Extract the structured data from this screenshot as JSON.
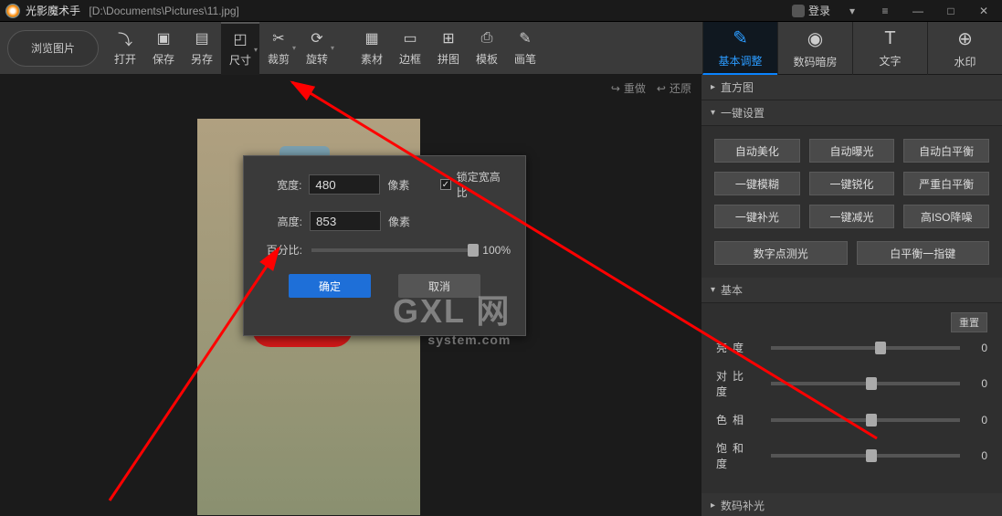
{
  "titlebar": {
    "app_name": "光影魔术手",
    "file_path": "[D:\\Documents\\Pictures\\11.jpg]",
    "login_label": "登录"
  },
  "toolbar": {
    "browse": "浏览图片",
    "items": [
      {
        "label": "打开",
        "icon": "⤵"
      },
      {
        "label": "保存",
        "icon": "▣"
      },
      {
        "label": "另存",
        "icon": "▤"
      },
      {
        "label": "尺寸",
        "icon": "◰"
      },
      {
        "label": "裁剪",
        "icon": "✂"
      },
      {
        "label": "旋转",
        "icon": "⟳"
      },
      {
        "label": "素材",
        "icon": "▦"
      },
      {
        "label": "边框",
        "icon": "▭"
      },
      {
        "label": "拼图",
        "icon": "⊞"
      },
      {
        "label": "模板",
        "icon": "⎙"
      },
      {
        "label": "画笔",
        "icon": "✎"
      }
    ],
    "right_tabs": [
      {
        "label": "基本调整",
        "icon": "✎"
      },
      {
        "label": "数码暗房",
        "icon": "◉"
      },
      {
        "label": "文字",
        "icon": "T"
      },
      {
        "label": "水印",
        "icon": "⊕"
      }
    ]
  },
  "subbar": {
    "redo": "重做",
    "restore": "还原"
  },
  "popup": {
    "width_label": "宽度:",
    "width_value": "480",
    "height_label": "高度:",
    "height_value": "853",
    "unit": "像素",
    "lock_label": "锁定宽高比",
    "percent_label": "百分比:",
    "percent_value": "100%",
    "ok": "确定",
    "cancel": "取消"
  },
  "panel": {
    "histogram": "直方图",
    "quickset": "一键设置",
    "quick": [
      "自动美化",
      "自动曝光",
      "自动白平衡",
      "一键模糊",
      "一键锐化",
      "严重白平衡",
      "一键补光",
      "一键减光",
      "高ISO降噪"
    ],
    "quick2": [
      "数字点测光",
      "白平衡一指键"
    ],
    "basic": "基本",
    "reset": "重置",
    "sliders": [
      {
        "label": "亮度",
        "value": "0",
        "pos": 55
      },
      {
        "label": "对比度",
        "value": "0",
        "pos": 50
      },
      {
        "label": "色相",
        "value": "0",
        "pos": 50
      },
      {
        "label": "饱和度",
        "value": "0",
        "pos": 50
      }
    ],
    "digital_fill": "数码补光"
  },
  "watermark": {
    "big": "GXL 网",
    "small": "system.com"
  }
}
